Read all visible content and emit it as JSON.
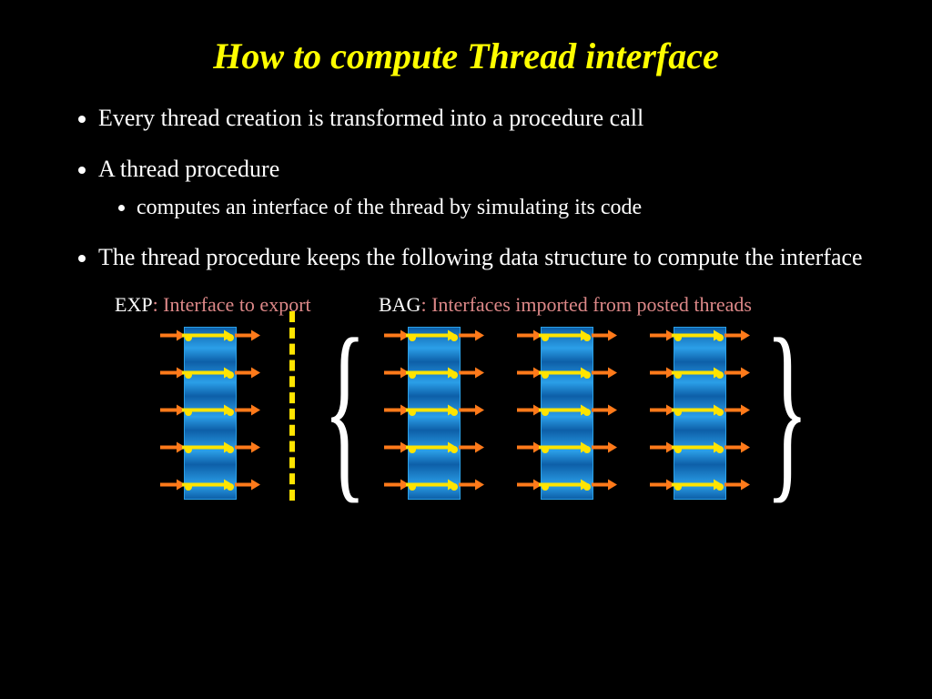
{
  "title": "How to compute Thread interface",
  "bullets": {
    "b1": "Every thread creation is transformed into a procedure call",
    "b2": "A thread procedure",
    "b2_sub": "computes an interface of the thread by simulating its code",
    "b3": "The thread procedure keeps the following data structure to compute the interface"
  },
  "labels": {
    "exp_key": "EXP",
    "exp_desc": ": Interface to export",
    "bag_key": "BAG",
    "bag_desc": ": Interfaces imported from posted threads"
  },
  "diagram": {
    "rows_per_block": 5,
    "bag_block_count": 3,
    "left_brace": "{",
    "right_brace": "}",
    "colors": {
      "arrow_orange": "#ff7a1a",
      "arrow_yellow": "#ffe400"
    }
  }
}
